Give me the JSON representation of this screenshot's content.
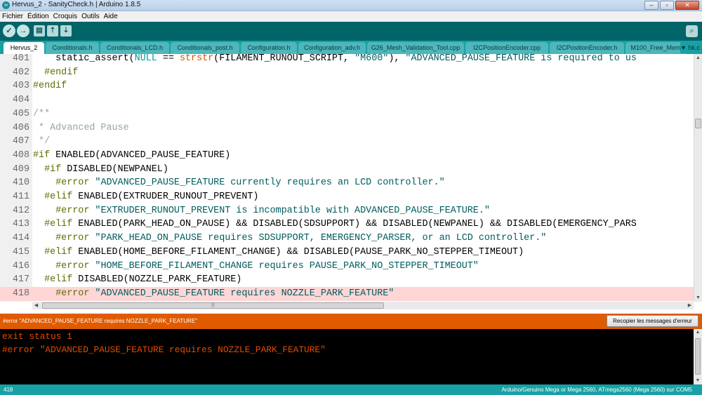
{
  "window": {
    "title": "Hervus_2 - SanityCheck.h | Arduino 1.8.5",
    "app_icon": "arduino-logo-icon",
    "controls": [
      "minimize-icon",
      "maximize-icon",
      "close-icon"
    ]
  },
  "menubar": [
    "Fichier",
    "Édition",
    "Croquis",
    "Outils",
    "Aide"
  ],
  "toolbar": {
    "buttons": [
      "verify-icon",
      "upload-icon",
      "new-icon",
      "open-icon",
      "save-icon"
    ],
    "serial_monitor_icon": "serial-monitor-icon",
    "glyphs": {
      "verify": "✓",
      "upload": "→",
      "new": "▤",
      "open": "⇡",
      "save": "⇣",
      "serial": "⌕"
    }
  },
  "tabs": {
    "items": [
      "Hervus_2",
      "Conditionals.h",
      "Conditionals_LCD.h",
      "Conditionals_post.h",
      "Configuration.h",
      "Configuration_adv.h",
      "G26_Mesh_Validation_Tool.cpp",
      "I2CPositionEncoder.cpp",
      "I2CPositionEncoder.h",
      "M100_Free_Mem"
    ],
    "menu_label": "▼ hk.c"
  },
  "editor": {
    "current_line": "418",
    "lines": [
      {
        "num": "401",
        "segments": [
          {
            "t": "    static_assert(",
            "c": "def"
          },
          {
            "t": "NULL",
            "c": "kw"
          },
          {
            "t": " == ",
            "c": "def"
          },
          {
            "t": "strstr",
            "c": "fn"
          },
          {
            "t": "(FILAMENT_RUNOUT_SCRIPT, ",
            "c": "def"
          },
          {
            "t": "\"M600\"",
            "c": "str"
          },
          {
            "t": "), ",
            "c": "def"
          },
          {
            "t": "\"ADVANCED_PAUSE_FEATURE is required to us",
            "c": "str"
          }
        ]
      },
      {
        "num": "402",
        "segments": [
          {
            "t": "  #endif",
            "c": "pp"
          }
        ]
      },
      {
        "num": "403",
        "segments": [
          {
            "t": "#endif",
            "c": "pp"
          }
        ]
      },
      {
        "num": "404",
        "segments": []
      },
      {
        "num": "405",
        "segments": [
          {
            "t": "/**",
            "c": "cm"
          }
        ]
      },
      {
        "num": "406",
        "segments": [
          {
            "t": " * Advanced Pause",
            "c": "cm"
          }
        ]
      },
      {
        "num": "407",
        "segments": [
          {
            "t": " */",
            "c": "cm"
          }
        ]
      },
      {
        "num": "408",
        "segments": [
          {
            "t": "#if",
            "c": "pp"
          },
          {
            "t": " ENABLED(ADVANCED_PAUSE_FEATURE)",
            "c": "def"
          }
        ]
      },
      {
        "num": "409",
        "segments": [
          {
            "t": "  #if",
            "c": "pp"
          },
          {
            "t": " DISABLED(NEWPANEL)",
            "c": "def"
          }
        ]
      },
      {
        "num": "410",
        "segments": [
          {
            "t": "    #error",
            "c": "pp"
          },
          {
            "t": " ",
            "c": "def"
          },
          {
            "t": "\"ADVANCED_PAUSE_FEATURE currently requires an LCD controller.\"",
            "c": "str"
          }
        ]
      },
      {
        "num": "411",
        "segments": [
          {
            "t": "  #elif",
            "c": "pp"
          },
          {
            "t": " ENABLED(EXTRUDER_RUNOUT_PREVENT)",
            "c": "def"
          }
        ]
      },
      {
        "num": "412",
        "segments": [
          {
            "t": "    #error",
            "c": "pp"
          },
          {
            "t": " ",
            "c": "def"
          },
          {
            "t": "\"EXTRUDER_RUNOUT_PREVENT is incompatible with ADVANCED_PAUSE_FEATURE.\"",
            "c": "str"
          }
        ]
      },
      {
        "num": "413",
        "segments": [
          {
            "t": "  #elif",
            "c": "pp"
          },
          {
            "t": " ENABLED(PARK_HEAD_ON_PAUSE) && DISABLED(SDSUPPORT) && DISABLED(NEWPANEL) && DISABLED(EMERGENCY_PARS",
            "c": "def"
          }
        ]
      },
      {
        "num": "414",
        "segments": [
          {
            "t": "    #error",
            "c": "pp"
          },
          {
            "t": " ",
            "c": "def"
          },
          {
            "t": "\"PARK_HEAD_ON_PAUSE requires SDSUPPORT, EMERGENCY_PARSER, or an LCD controller.\"",
            "c": "str"
          }
        ]
      },
      {
        "num": "415",
        "segments": [
          {
            "t": "  #elif",
            "c": "pp"
          },
          {
            "t": " ENABLED(HOME_BEFORE_FILAMENT_CHANGE) && DISABLED(PAUSE_PARK_NO_STEPPER_TIMEOUT)",
            "c": "def"
          }
        ]
      },
      {
        "num": "416",
        "segments": [
          {
            "t": "    #error",
            "c": "pp"
          },
          {
            "t": " ",
            "c": "def"
          },
          {
            "t": "\"HOME_BEFORE_FILAMENT_CHANGE requires PAUSE_PARK_NO_STEPPER_TIMEOUT\"",
            "c": "str"
          }
        ]
      },
      {
        "num": "417",
        "segments": [
          {
            "t": "  #elif",
            "c": "pp"
          },
          {
            "t": " DISABLED(NOZZLE_PARK_FEATURE)",
            "c": "def"
          }
        ]
      },
      {
        "num": "418",
        "segments": [
          {
            "t": "    #error",
            "c": "pp"
          },
          {
            "t": " ",
            "c": "def"
          },
          {
            "t": "\"ADVANCED_PAUSE_FEATURE requires NOZZLE_PARK_FEATURE\"",
            "c": "str"
          }
        ]
      }
    ],
    "highlight_color": "#ffd6d6"
  },
  "scrollbars": {
    "horizontal_grip": "|||"
  },
  "status": {
    "message": "#error \"ADVANCED_PAUSE_FEATURE requires NOZZLE_PARK_FEATURE\"",
    "copy_button": "Recopier les messages d'erreur",
    "color": "#e05a00"
  },
  "console": {
    "lines": [
      "exit status 1",
      "#error \"ADVANCED_PAUSE_FEATURE requires NOZZLE_PARK_FEATURE\""
    ],
    "text_color": "#e34c00"
  },
  "footer": {
    "line_number": "418",
    "board": "Arduino/Genuino Mega or Mega 2560, ATmega2560 (Mega 2560) sur COM5"
  }
}
